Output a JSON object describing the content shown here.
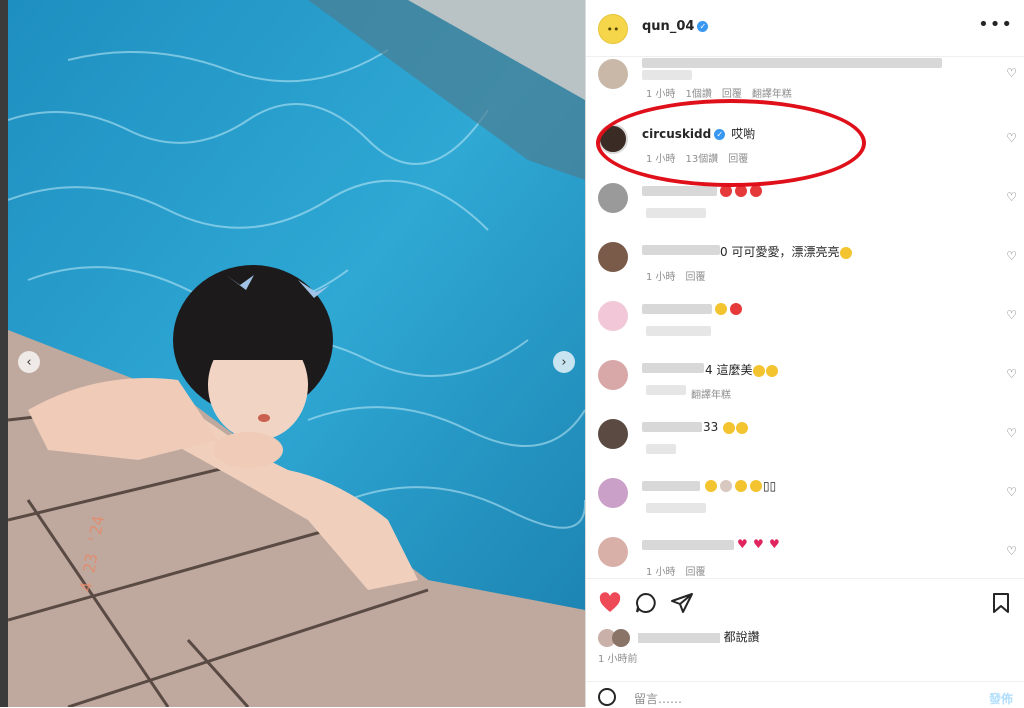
{
  "header": {
    "username": "qun_04",
    "more_label": "•••",
    "avatar_glyph": "••"
  },
  "comments": [
    {
      "name": "",
      "text": "",
      "meta": [
        "1 小時",
        "1個讚",
        "回覆",
        "翻譯年糕"
      ]
    },
    {
      "name": "circuskidd",
      "text": "哎喲",
      "meta": [
        "1 小時",
        "13個讚",
        "回覆"
      ]
    },
    {
      "name": "",
      "text": "",
      "meta": []
    },
    {
      "name": "",
      "text": "0 可可愛愛，漂漂亮亮",
      "meta": [
        "1 小時",
        "回覆"
      ]
    },
    {
      "name": "",
      "text": "",
      "meta": []
    },
    {
      "name": "",
      "text": "4 這麼美",
      "meta": [
        "翻譯年糕"
      ]
    },
    {
      "name": "",
      "text": "33",
      "meta": []
    },
    {
      "name": "",
      "text": "▯▯",
      "meta": []
    },
    {
      "name": "",
      "text": "",
      "meta": [
        "1 小時",
        "回覆"
      ]
    }
  ],
  "likes_text": "都說讚",
  "time_text": "1 小時前",
  "comment_box": {
    "placeholder": "留言……",
    "post_label": "發佈"
  },
  "photo": {
    "date_stamp": "4 23 '24"
  },
  "colors": {
    "annotation": "#e0101a",
    "like_heart": "#ed4956",
    "verified": "#3897f0"
  },
  "icons": [
    "heart-icon",
    "comment-icon",
    "share-icon",
    "bookmark-icon",
    "emoji-icon",
    "more-icon",
    "verified-icon"
  ]
}
